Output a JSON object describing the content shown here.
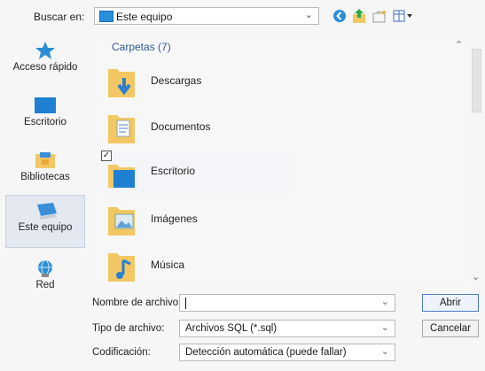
{
  "toolbar": {
    "lookin_label": "Buscar en:",
    "lookin_value": "Este equipo",
    "icons": [
      "back-icon",
      "up-folder-icon",
      "new-folder-icon",
      "views-menu-icon"
    ]
  },
  "places": [
    {
      "name": "place-acceso-rapido",
      "label": "Acceso rápido",
      "icon": "star-icon"
    },
    {
      "name": "place-escritorio",
      "label": "Escritorio",
      "icon": "desktop-icon"
    },
    {
      "name": "place-bibliotecas",
      "label": "Bibliotecas",
      "icon": "libraries-icon"
    },
    {
      "name": "place-este-equipo",
      "label": "Este equipo",
      "icon": "computer-icon",
      "selected": true
    },
    {
      "name": "place-red",
      "label": "Red",
      "icon": "network-icon"
    }
  ],
  "filelist": {
    "group_header": "Carpetas (7)",
    "items": [
      {
        "label": "Descargas",
        "icon": "downloads-folder-icon"
      },
      {
        "label": "Documentos",
        "icon": "documents-folder-icon"
      },
      {
        "label": "Escritorio",
        "icon": "desktop-folder-icon",
        "checked": true
      },
      {
        "label": "Imágenes",
        "icon": "pictures-folder-icon"
      },
      {
        "label": "Música",
        "icon": "music-folder-icon"
      }
    ]
  },
  "form": {
    "filename_label": "Nombre de archivo:",
    "filename_value": "",
    "filetype_label": "Tipo de archivo:",
    "filetype_value": "Archivos SQL (*.sql)",
    "encoding_label": "Codificación:",
    "encoding_value": "Detección automática (puede fallar)",
    "open_label": "Abrir",
    "cancel_label": "Cancelar"
  },
  "colors": {
    "accent": "#2a8ed8",
    "folder": "#f3c763",
    "group_header": "#2f5a9e"
  }
}
